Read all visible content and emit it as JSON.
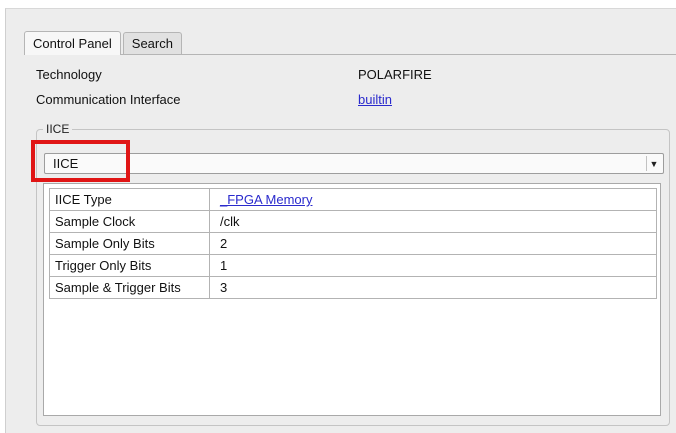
{
  "tabs": [
    {
      "label": "Control Panel",
      "active": true
    },
    {
      "label": "Search",
      "active": false
    }
  ],
  "properties": {
    "technology_label": "Technology",
    "technology_value": "POLARFIRE",
    "comm_label": "Communication Interface",
    "comm_value": "builtin"
  },
  "iice_group": {
    "legend": "IICE",
    "selected": "IICE",
    "dropdown_icon": "chevron-down-icon"
  },
  "iice_table": {
    "rows": [
      {
        "key": "IICE Type",
        "value": "_FPGA Memory",
        "is_link": true
      },
      {
        "key": "Sample Clock",
        "value": "/clk",
        "is_link": false
      },
      {
        "key": "Sample Only Bits",
        "value": "2",
        "is_link": false
      },
      {
        "key": "Trigger Only Bits",
        "value": "1",
        "is_link": false
      },
      {
        "key": "Sample & Trigger Bits",
        "value": "3",
        "is_link": false
      }
    ]
  },
  "colors": {
    "highlight": "#e01515",
    "link": "#2a2acd",
    "panel": "#ededed"
  }
}
